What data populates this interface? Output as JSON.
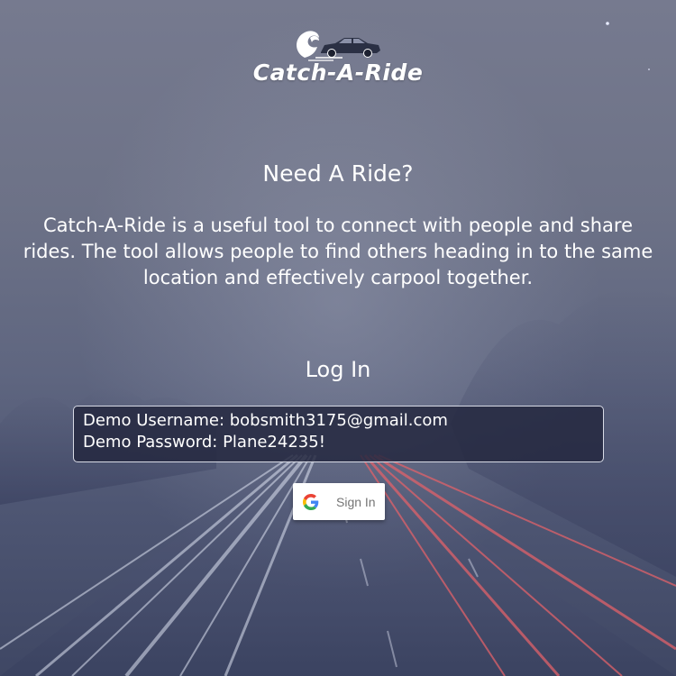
{
  "brand": {
    "name": "Catch-A-Ride",
    "logo_icon": "wave-car-logo-icon"
  },
  "hero": {
    "headline": "Need A Ride?",
    "description": "Catch-A-Ride is a useful tool to connect with people and share rides. The tool allows people to find others heading in to the same location and effectively carpool together."
  },
  "login": {
    "heading": "Log In",
    "demo_username_line": "Demo Username: bobsmith3175@gmail.com",
    "demo_password_line": "Demo Password: Plane24235!",
    "google_button": {
      "label": "Sign In",
      "icon": "google-g-icon"
    }
  },
  "colors": {
    "background_top": "#767a8f",
    "background_bottom": "#3f4764",
    "demo_box_bg": "#242840",
    "light_trail_red": "#e0626a",
    "light_trail_white": "#dfe3f2"
  }
}
